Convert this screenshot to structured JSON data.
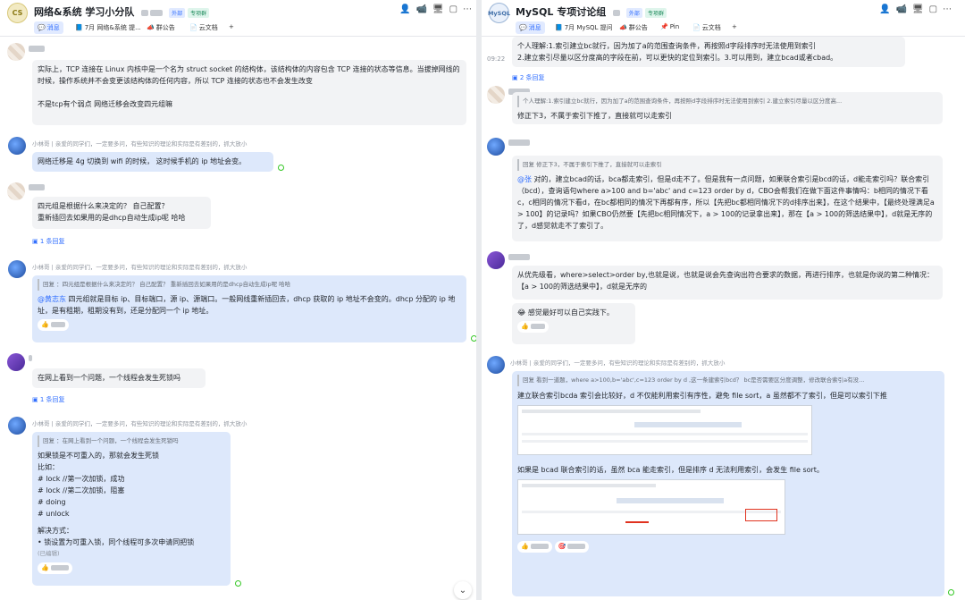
{
  "left": {
    "avatar": "CS",
    "title": "网络&系统 学习小分队",
    "tag_ext": "外部",
    "tag_label": "专项群",
    "tabs": [
      "消息",
      "7月 网络&系统 提...",
      "群公告",
      "云文档"
    ],
    "tab_plus": "+",
    "messages": {
      "m1": [
        "实际上，TCP 连接在 Linux 内核中是一个名为 struct socket 的结构体，该结构体的内容包含 TCP 连接的状态等信息。当拔掉网线的时候，操作系统并不会变更该结构体的任何内容，所以 TCP 连接的状态也不会发生改变",
        "不是tcp有个弱点  网络迁移会改变四元组嘛"
      ],
      "name2": "小林哥 | 亲爱的同学们，一定要多问，有些知识的理论和实际是有差别的，抓大放小",
      "m2": "网络迁移是 4g 切换到 wifi 的时候， 这时候手机的 ip 地址会变。",
      "m3a": "四元组是根据什么来决定的？ 自己配置？",
      "m3b": "重新插回去如果用的是dhcp自动生成ip呢  哈哈",
      "reply3": "1 条回复",
      "name4": "小林哥 | 亲爱的同学们，一定要多问，有些知识的理论和实际是有差别的，抓大放小",
      "q4": "回复       ：四元组是根据什么来决定的？ 自己配置？ 重新插回去如果用的是dhcp自动生成ip呢 哈哈",
      "at4": "@黄志东",
      "m4": " 四元组就是目标 ip、目标端口，源 ip、源端口。一般网线重新插回去，dhcp 获取的 ip 地址不会变的。dhcp 分配的 ip 地址，是有租期，租期没有到，还是分配同一个 ip 地址。",
      "react4": "👍",
      "m5": "在网上看到一个问题，一个线程会发生死锁吗",
      "reply5": "1 条回复",
      "name6": "小林哥 | 亲爱的同学们，一定要多问，有些知识的理论和实际是有差别的，抓大放小",
      "q6": "回复        ：在网上看到一个问题，一个线程会发生死锁吗",
      "m6": [
        "如果锁是不可重入的，那就会发生死锁",
        "比如：",
        "# lock  //第一次加锁，成功",
        "# lock  //第二次加锁，阻塞",
        "# doing",
        "# unlock",
        "",
        "解决方式：",
        "•  锁设置为可重入锁，同个线程可多次申请同把锁"
      ],
      "edited": "(已编辑)",
      "react6": "👍"
    }
  },
  "right": {
    "avatar": "MySQL",
    "title": "MySQL 专项讨论组",
    "tag_ext": "外部",
    "tag_label": "专项群",
    "tabs": [
      "消息",
      "7月 MySQL 提问",
      "群公告",
      "Pin",
      "云文档"
    ],
    "tab_plus": "+",
    "time1": "09:22",
    "r1": [
      "个人理解:1.索引建立bc就行，因为加了a的范围查询条件，再按照d字段排序时无法使用到索引",
      "2.建立索引尽量以区分度高的字段在前，可以更快的定位到索引。3.可以用到，建立bcad或者cbad。"
    ],
    "reply1": "2 条回复",
    "q2": "个人理解:1.索引建立bc就行，因为加了a的范围查询条件，再按照d字段排序时无法使用到索引 2.建立索引尽量以区分度高...",
    "r2": "修正下3，不属于索引下推了，直接就可以走索引",
    "q3": "回复       修正下3，不属于索引下推了，直接就可以走索引",
    "at3": "@张",
    "r3": "    对的，建立bcad的话，bca都走索引，但是d走不了。但是我有一点问题，如果联合索引是bcd的话，d能走索引吗？联合索引（bcd），查询语句where a>100 and b='abc' and c=123 order by d，CBO会帮我们在做下面这件事情吗：b相同的情况下看c，c相同的情况下看d，在bc都相同的情况下再都有序，所以【先把bc都相同情况下的d排序出来】，在这个结果中，【最终处理满足a > 100】的记录吗？如果CBO仍然要【先把bc相同情况下，a > 100的记录拿出来】，那在【a > 100的筛选结果中】，d就是无序的了，d感觉就走不了索引了。",
    "r4": "从优先级看，where>select>order by,也就是说，也就是说会先查询出符合要求的数据，再进行排序，也就是你说的第二种情况：【a > 100的筛选结果中】，d就是无序的",
    "r4b": "😂 感觉最好可以自己实践下。",
    "react4": "👍",
    "name5": "小林哥 | 亲爱的同学们，一定要多问，有些知识的理论和实际是有差别的，抓大放小",
    "q5": "回复        看到一道题，where a>100,b='abc',c=123 order by d ,这一条建索引bcd？ bc是否需要区分度调整，修改联合索引a有没...",
    "r5a": "建立联合索引bcda 索引会比较好，d 不仅能利用索引有序性，避免 file sort，a 虽然都不了索引，但是可以索引下推",
    "r5b": "如果是 bcad 联合索引的话，虽然 bca 能走索引，但是排序 d 无法利用索引，会发生 file sort。",
    "react5a": "👍",
    "react5b": "🎯"
  }
}
